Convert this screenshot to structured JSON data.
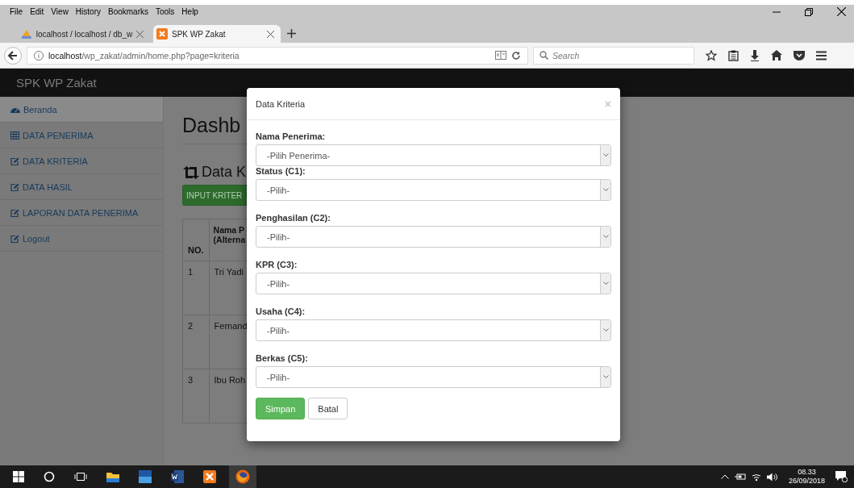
{
  "browser": {
    "menu": [
      "File",
      "Edit",
      "View",
      "History",
      "Bookmarks",
      "Tools",
      "Help"
    ],
    "tabs": [
      {
        "title": "localhost / localhost / db_w",
        "selected": false
      },
      {
        "title": "SPK WP Zakat",
        "selected": true
      }
    ],
    "address": {
      "host": "localhost",
      "path": "/wp_zakat/admin/home.php?page=kriteria"
    },
    "search": {
      "placeholder": "Search"
    }
  },
  "app": {
    "brand": "SPK WP Zakat",
    "sidebar": [
      {
        "label": "Beranda",
        "kind": "dashboard",
        "selected": true
      },
      {
        "label": "DATA PENERIMA",
        "kind": "table",
        "selected": false
      },
      {
        "label": "DATA KRITERIA",
        "kind": "edit",
        "selected": false
      },
      {
        "label": "DATA HASIL",
        "kind": "edit",
        "selected": false
      },
      {
        "label": "LAPORAN DATA PENERIMA",
        "kind": "edit",
        "selected": false
      },
      {
        "label": "Logout",
        "kind": "edit",
        "selected": false
      }
    ],
    "heading": "Dashb",
    "section_title": "Data K",
    "input_button": "INPUT KRITER",
    "table": {
      "columns": [
        "NO.",
        "Nama P (Alterna"
      ],
      "rows": [
        [
          "1",
          "Tri Yadi"
        ],
        [
          "2",
          "Fernand"
        ],
        [
          "3",
          "Ibu Roh"
        ]
      ]
    }
  },
  "modal": {
    "title": "Data Kriteria",
    "close": "×",
    "fields": [
      {
        "label": "Nama Penerima:",
        "placeholder": "-Pilih Penerima-"
      },
      {
        "label": "Status (C1):",
        "placeholder": "-Pilih-"
      },
      {
        "label": "Penghasilan (C2):",
        "placeholder": "-Pilih-"
      },
      {
        "label": "KPR (C3):",
        "placeholder": "-Pilih-"
      },
      {
        "label": "Usaha (C4):",
        "placeholder": "-Pilih-"
      },
      {
        "label": "Berkas (C5):",
        "placeholder": "-Pilih-"
      }
    ],
    "buttons": [
      {
        "label": "Simpan",
        "kind": "primary"
      },
      {
        "label": "Batal",
        "kind": "default"
      }
    ]
  },
  "taskbar": {
    "time": "08.33",
    "date": "26/09/2018"
  }
}
